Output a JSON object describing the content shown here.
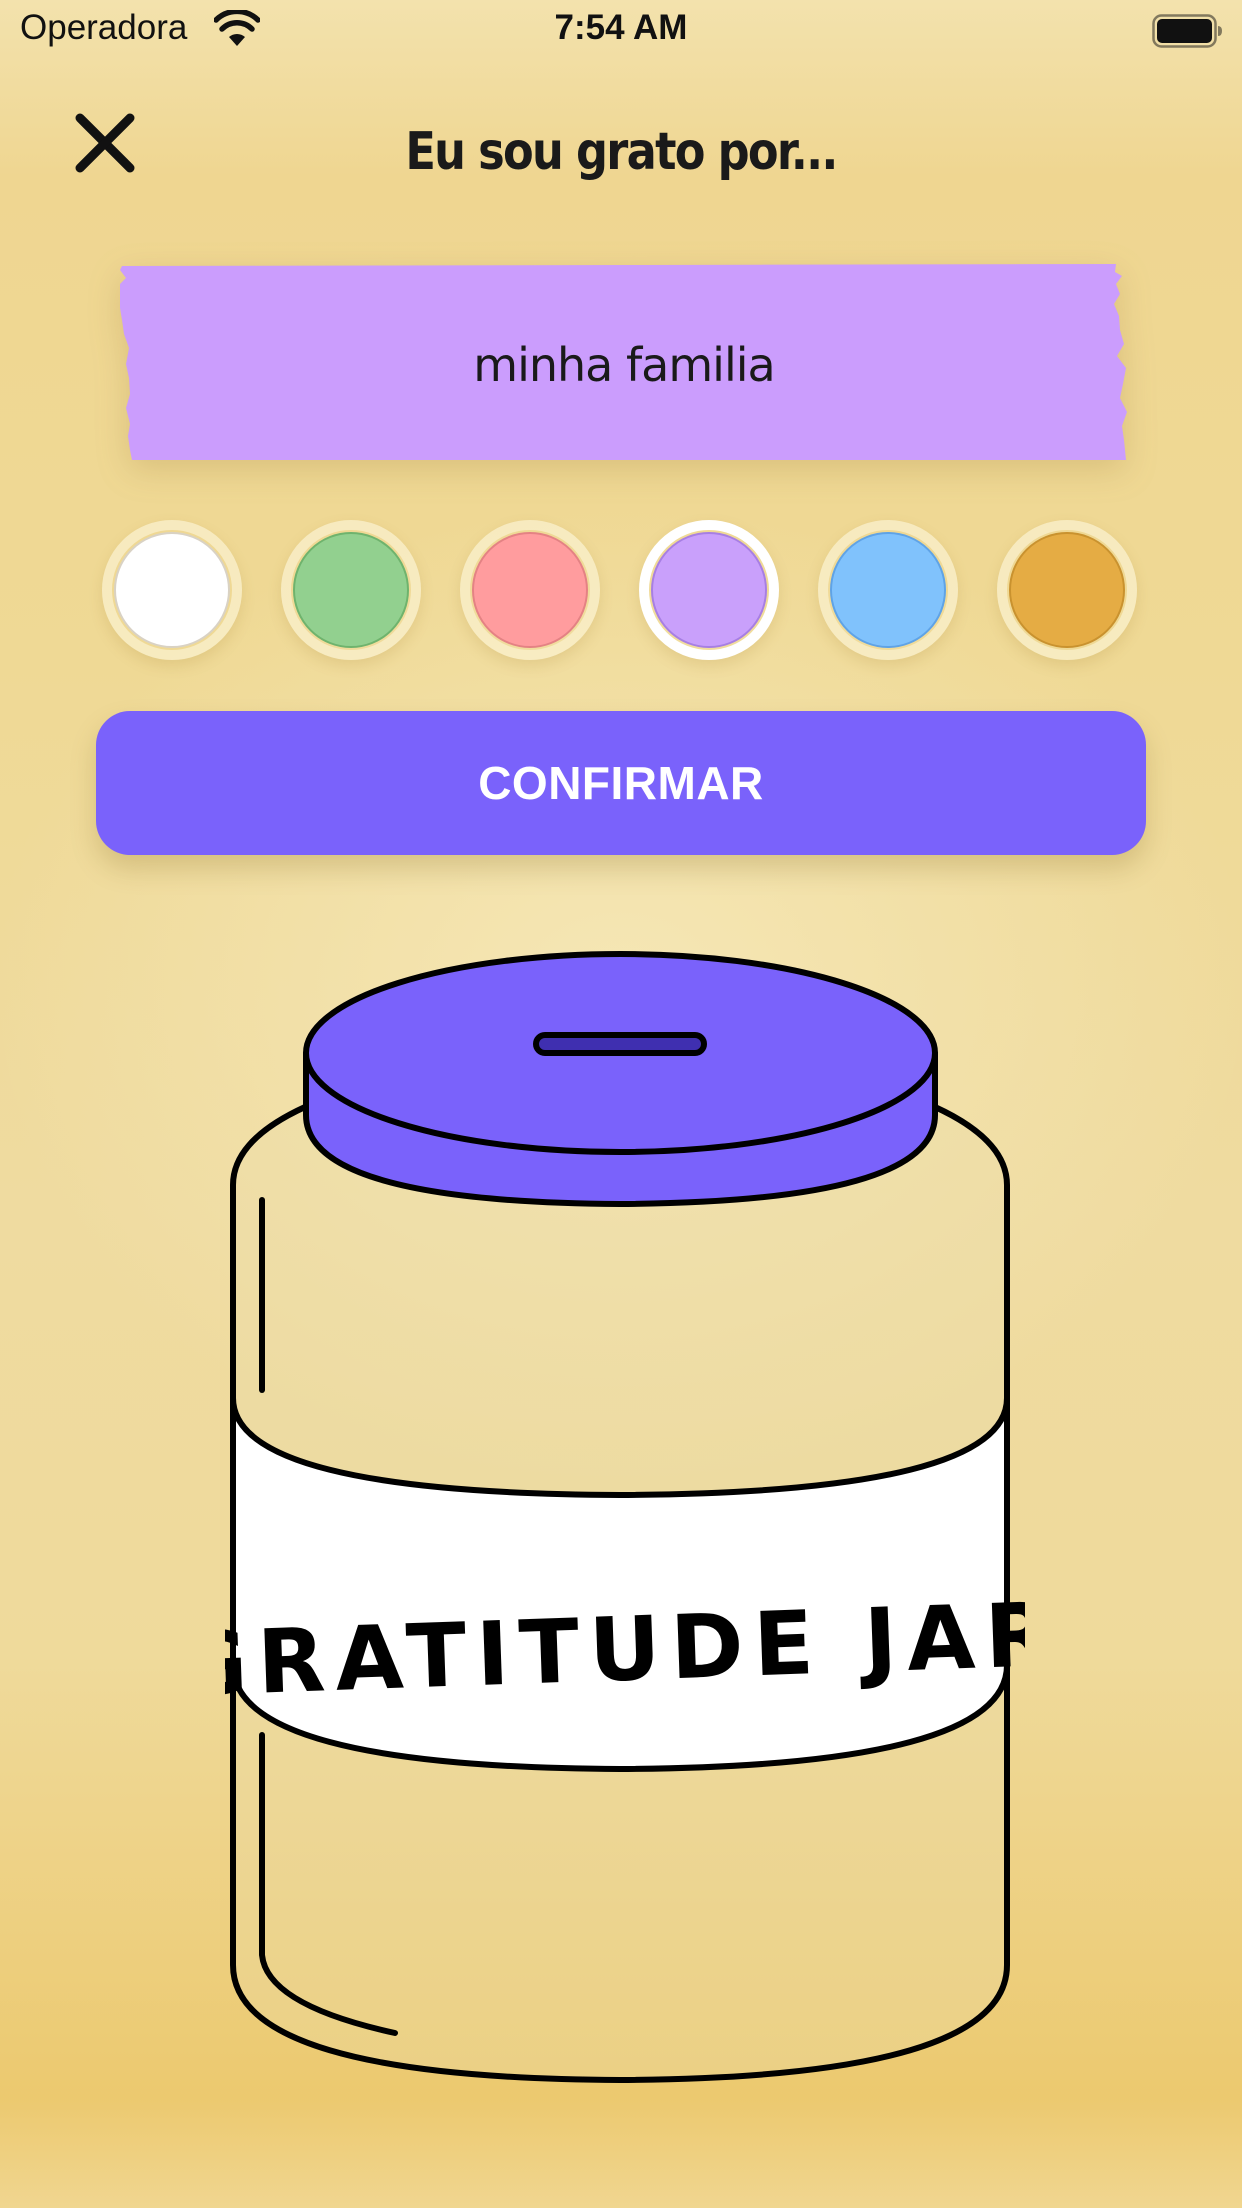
{
  "status_bar": {
    "carrier": "Operadora",
    "time": "7:54 AM",
    "wifi_icon": "wifi-icon",
    "battery_icon": "battery-full-icon"
  },
  "header": {
    "close_icon": "close-icon",
    "title": "Eu sou grato por..."
  },
  "note": {
    "value": "minha familia",
    "selected_color": "#cb9dfd"
  },
  "color_picker": {
    "options": [
      {
        "name": "white",
        "color": "#ffffff",
        "stroke": "#d9d2c4",
        "selected": false
      },
      {
        "name": "green",
        "color": "#92d08f",
        "stroke": "#6fb36d",
        "selected": false
      },
      {
        "name": "pink",
        "color": "#ff9c9e",
        "stroke": "#e48284",
        "selected": false
      },
      {
        "name": "purple",
        "color": "#c9a0fb",
        "stroke": "#a77fe3",
        "selected": true
      },
      {
        "name": "blue",
        "color": "#80c2fc",
        "stroke": "#5fa3e6",
        "selected": false
      },
      {
        "name": "orange",
        "color": "#e5ac44",
        "stroke": "#c9922f",
        "selected": false
      }
    ]
  },
  "confirm": {
    "label": "CONFIRMAR"
  },
  "jar": {
    "label": "GRATITUDE JAR",
    "lid_color": "#7a62fb"
  },
  "colors": {
    "accent": "#7a62fb",
    "background": "#efd995"
  }
}
